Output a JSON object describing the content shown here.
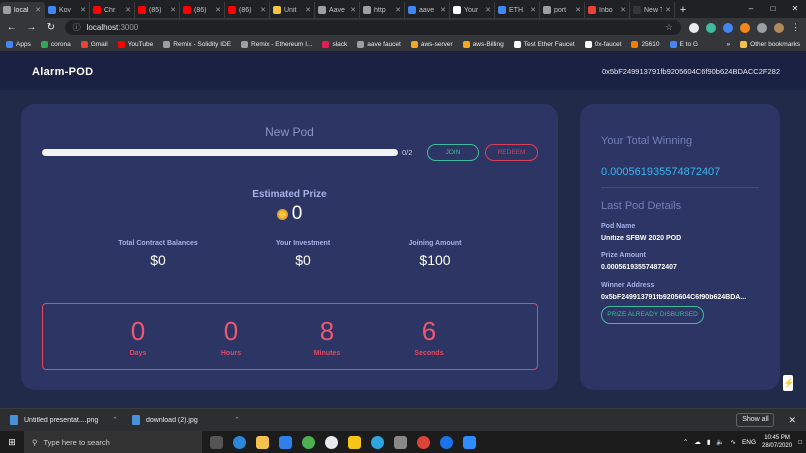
{
  "browser": {
    "tabs": [
      {
        "label": "local",
        "color": "#9aa0a6",
        "active": true
      },
      {
        "label": "Kov",
        "color": "#4285f4"
      },
      {
        "label": "Chr",
        "color": "#ff0000"
      },
      {
        "label": "(85)",
        "color": "#ff0000"
      },
      {
        "label": "(86)",
        "color": "#ff0000"
      },
      {
        "label": "(86)",
        "color": "#ff0000"
      },
      {
        "label": "Unit",
        "color": "#f5c542"
      },
      {
        "label": "Aave",
        "color": "#9aa0a6"
      },
      {
        "label": "http",
        "color": "#9aa0a6"
      },
      {
        "label": "aave",
        "color": "#4285f4"
      },
      {
        "label": "Your",
        "color": "#ffffff"
      },
      {
        "label": "ETH",
        "color": "#4285f4"
      },
      {
        "label": "port",
        "color": "#9aa0a6"
      },
      {
        "label": "Inbo",
        "color": "#ea4335"
      },
      {
        "label": "New Tab",
        "color": "#35363a"
      }
    ],
    "new_tab": "+",
    "url_host": "localhost",
    "url_port": ":3000",
    "bookmarks": [
      {
        "label": "Apps",
        "color": "#4285f4"
      },
      {
        "label": "corona",
        "color": "#34a853"
      },
      {
        "label": "Gmail",
        "color": "#ea4335"
      },
      {
        "label": "YouTube",
        "color": "#ff0000"
      },
      {
        "label": "Remix - Solidity IDE",
        "color": "#9aa0a6"
      },
      {
        "label": "Remix - Ethereum I...",
        "color": "#9aa0a6"
      },
      {
        "label": "slack",
        "color": "#e01e5a"
      },
      {
        "label": "aave faucet",
        "color": "#9aa0a6"
      },
      {
        "label": "aws-server",
        "color": "#f5a623"
      },
      {
        "label": "aws-Billing",
        "color": "#f5a623"
      },
      {
        "label": "Test Ether Faucet",
        "color": "#ffffff"
      },
      {
        "label": "0x-faucet",
        "color": "#ffffff"
      },
      {
        "label": "25610",
        "color": "#f57c00"
      },
      {
        "label": "E to G",
        "color": "#4285f4"
      }
    ],
    "bookmarks_more": "»",
    "other_bookmarks": "Other bookmarks"
  },
  "app": {
    "title": "Alarm-POD",
    "wallet_address": "0x5bF249913791fb9205604C6f90b624BDACC2F282"
  },
  "pod": {
    "title": "New Pod",
    "progress": 1.0,
    "participants_text": "0/2",
    "join_label": "JOIN",
    "redeem_label": "REDEEM",
    "estimated_prize_label": "Estimated Prize",
    "estimated_prize_value": "0",
    "stats": [
      {
        "label": "Total Contract Balances",
        "value": "$0"
      },
      {
        "label": "Your Investment",
        "value": "$0"
      },
      {
        "label": "Joining Amount",
        "value": "$100"
      }
    ],
    "countdown": [
      {
        "value": "0",
        "unit": "Days"
      },
      {
        "value": "0",
        "unit": "Hours"
      },
      {
        "value": "8",
        "unit": "Minutes"
      },
      {
        "value": "6",
        "unit": "Seconds"
      }
    ]
  },
  "side": {
    "total_winning_label": "Your Total Winning",
    "total_winning_value": "0.000561935574872407",
    "last_pod_heading": "Last Pod Details",
    "pod_name_label": "Pod Name",
    "pod_name_value": "Unitize SFBW 2020 POD",
    "prize_label": "Prize Amount",
    "prize_value": "0.000561935574872407",
    "winner_label": "Winner Address",
    "winner_value": "0x5bF249913791fb9205604C6f90b624BDA...",
    "disbursed_label": "PRIZE ALREADY DISBURSED"
  },
  "downloads": {
    "items": [
      {
        "name": "Untitled presentat....png"
      },
      {
        "name": "download (2).jpg"
      }
    ],
    "show_all": "Show all"
  },
  "taskbar": {
    "search_placeholder": "Type here to search",
    "lang": "ENG",
    "time": "10:45 PM",
    "date": "28/07/2020"
  }
}
